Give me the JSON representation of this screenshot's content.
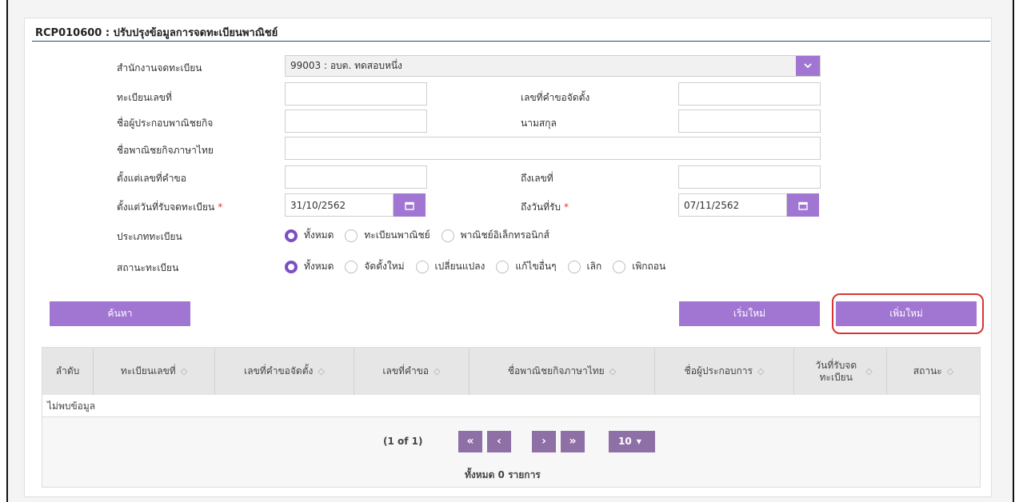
{
  "page": {
    "title": "RCP010600 : ปรับปรุงข้อมูลการจดทะเบียนพาณิชย์"
  },
  "form": {
    "office_label": "สำนักงานจดทะเบียน",
    "office_value": "99003 : อบต. ทดสอบหนึ่ง",
    "reg_no_label": "ทะเบียนเลขที่",
    "reg_no_value": "",
    "request_no_label": "เลขที่คำขอจัดตั้ง",
    "request_no_value": "",
    "operator_name_label": "ชื่อผู้ประกอบพาณิชยกิจ",
    "operator_name_value": "",
    "surname_label": "นามสกุล",
    "surname_value": "",
    "business_name_label": "ชื่อพาณิชยกิจภาษาไทย",
    "business_name_value": "",
    "from_request_label": "ตั้งแต่เลขที่คำขอ",
    "from_request_value": "",
    "to_no_label": "ถึงเลขที่",
    "to_no_value": "",
    "from_date_label": "ตั้งแต่วันที่รับจดทะเบียน",
    "from_date_value": "31/10/2562",
    "to_date_label": "ถึงวันที่รับ",
    "to_date_value": "07/11/2562",
    "required_mark": "*",
    "reg_type_label": "ประเภททะเบียน",
    "reg_type_options": [
      "ทั้งหมด",
      "ทะเบียนพาณิชย์",
      "พาณิชย์อิเล็กทรอนิกส์"
    ],
    "reg_type_selected": 0,
    "status_label": "สถานะทะเบียน",
    "status_options": [
      "ทั้งหมด",
      "จัดตั้งใหม่",
      "เปลี่ยนแปลง",
      "แก้ไขอื่นๆ",
      "เลิก",
      "เพิกถอน"
    ],
    "status_selected": 0
  },
  "buttons": {
    "search": "ค้นหา",
    "reset": "เริ่มใหม่",
    "add_new": "เพิ่มใหม่"
  },
  "table": {
    "columns": [
      "ลำดับ",
      "ทะเบียนเลขที่",
      "เลขที่คำขอจัดตั้ง",
      "เลขที่คำขอ",
      "ชื่อพาณิชยกิจภาษาไทย",
      "ชื่อผู้ประกอบการ",
      "วันที่รับจด ทะเบียน",
      "สถานะ"
    ],
    "empty_text": "ไม่พบข้อมูล"
  },
  "pager": {
    "page_info": "(1 of 1)",
    "first": "«",
    "prev": "‹",
    "next": "›",
    "last": "»",
    "rows_per_page": "10",
    "total": "ทั้งหมด 0 รายการ"
  },
  "colors": {
    "accent": "#a076d2",
    "pager": "#8e6fa6",
    "highlight": "#d83434"
  }
}
